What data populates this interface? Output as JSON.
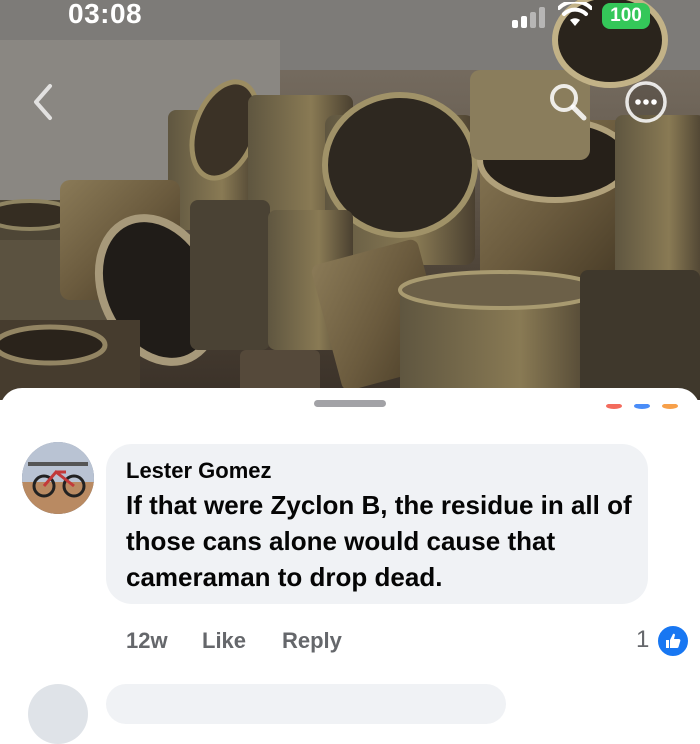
{
  "status_bar": {
    "time": "03:08",
    "battery": "100"
  },
  "nav": {
    "back_icon": "chevron-left-icon",
    "search_icon": "search-icon",
    "more_icon": "more-horizontal-icon"
  },
  "comment": {
    "author": "Lester Gomez",
    "text": "If that were Zyclon B, the residue in all of those cans alone would cause that cameraman to drop dead.",
    "age": "12w",
    "like_label": "Like",
    "reply_label": "Reply",
    "reaction_count": "1",
    "reaction_icon": "thumbs-up-icon"
  },
  "colors": {
    "accent": "#1877f2",
    "battery": "#34c759",
    "bubble": "#f0f2f5",
    "meta_text": "#65676b"
  }
}
